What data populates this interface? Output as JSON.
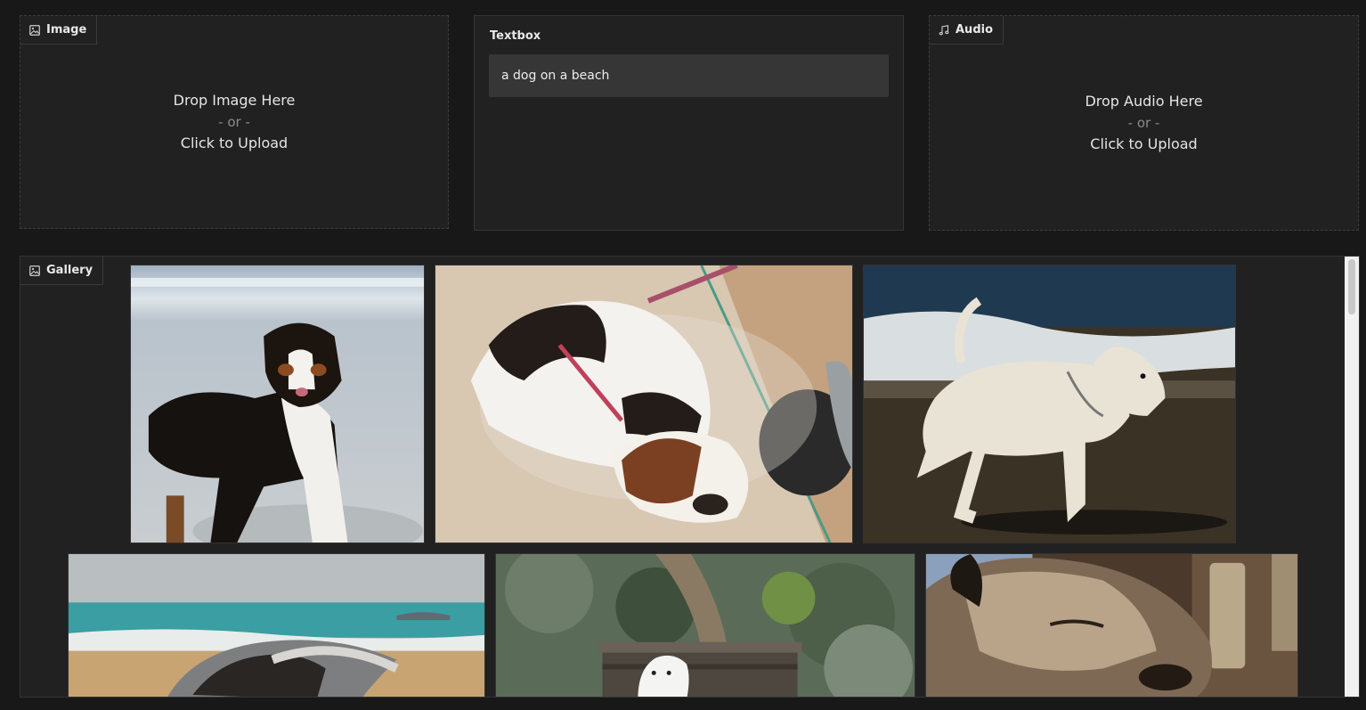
{
  "image_input": {
    "label": "Image",
    "icon": "image-icon",
    "drop_text": "Drop Image Here",
    "or_text": "- or -",
    "upload_text": "Click to Upload"
  },
  "textbox": {
    "label": "Textbox",
    "value": "a dog on a beach"
  },
  "audio_input": {
    "label": "Audio",
    "icon": "music-icon",
    "drop_text": "Drop Audio Here",
    "or_text": "- or -",
    "upload_text": "Click to Upload"
  },
  "gallery": {
    "label": "Gallery",
    "icon": "image-icon",
    "images": [
      {
        "subject": "australian-shepherd-on-beach"
      },
      {
        "subject": "beagle-sleeping-in-sand"
      },
      {
        "subject": "white-dog-running-on-beach"
      },
      {
        "subject": "fluffy-dog-at-seashore"
      },
      {
        "subject": "westie-on-bench-in-shrubs"
      },
      {
        "subject": "terrier-closeup"
      }
    ]
  },
  "colors": {
    "background": "#181818",
    "panel": "#212121",
    "input": "#363636"
  }
}
